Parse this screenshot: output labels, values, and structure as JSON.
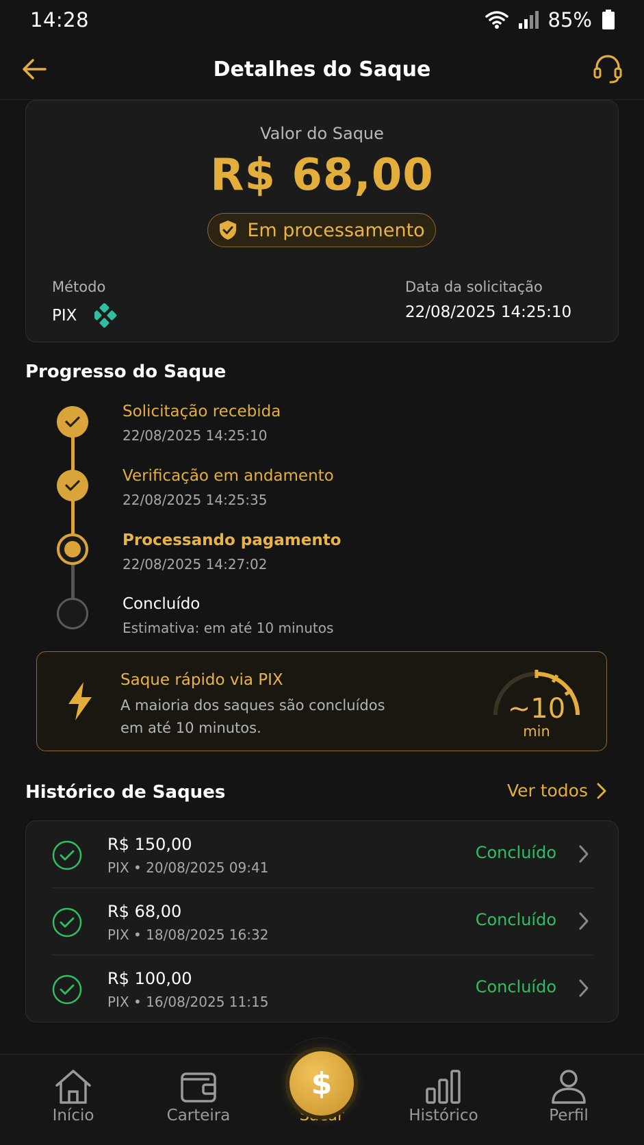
{
  "status_bar": {
    "time": "14:28",
    "battery": "85%"
  },
  "header": {
    "title": "Detalhes do Saque"
  },
  "summary": {
    "label": "Valor do Saque",
    "amount": "R$ 68,00",
    "status": "Em processamento",
    "method_label": "Método",
    "method_value": "PIX",
    "date_label": "Data da solicitação",
    "date_value": "22/08/2025 14:25:10"
  },
  "progress": {
    "title": "Progresso do Saque",
    "steps": [
      {
        "title": "Solicitação recebida",
        "subtitle": "22/08/2025 14:25:10",
        "state": "done"
      },
      {
        "title": "Verificação em andamento",
        "subtitle": "22/08/2025 14:25:35",
        "state": "done"
      },
      {
        "title": "Processando pagamento",
        "subtitle": "22/08/2025 14:27:02",
        "state": "current"
      },
      {
        "title": "Concluído",
        "subtitle": "Estimativa: em até 10 minutos",
        "state": "pending"
      }
    ]
  },
  "pix_info": {
    "title": "Saque rápido via PIX",
    "description": "A maioria dos saques são concluídos em até 10 minutos.",
    "gauge_value": "~10",
    "gauge_unit": "min"
  },
  "history": {
    "title": "Histórico de Saques",
    "see_all": "Ver todos",
    "items": [
      {
        "amount": "R$ 150,00",
        "meta": "PIX • 20/08/2025 09:41",
        "status": "Concluído"
      },
      {
        "amount": "R$ 68,00",
        "meta": "PIX • 18/08/2025 16:32",
        "status": "Concluído"
      },
      {
        "amount": "R$ 100,00",
        "meta": "PIX • 16/08/2025 11:15",
        "status": "Concluído"
      }
    ]
  },
  "nav": {
    "items": [
      {
        "label": "Início",
        "icon": "home-icon"
      },
      {
        "label": "Carteira",
        "icon": "wallet-icon"
      },
      {
        "label": "Sacar",
        "icon": "dollar-icon",
        "active": true
      },
      {
        "label": "Histórico",
        "icon": "bar-chart-icon"
      },
      {
        "label": "Perfil",
        "icon": "user-icon"
      }
    ]
  },
  "colors": {
    "accent": "#e3ae3c",
    "success": "#2fbf62",
    "background": "#141414",
    "pix": "#32bca2"
  }
}
